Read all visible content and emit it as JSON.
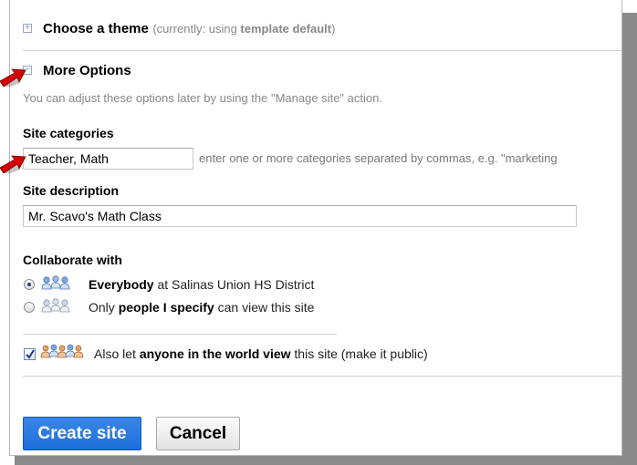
{
  "theme_section": {
    "title": "Choose a theme",
    "currently_prefix": "(currently: using ",
    "currently_value": "template default",
    "currently_suffix": ")"
  },
  "more_options": {
    "title": "More Options",
    "note": "You can adjust these options later by using the \"Manage site\" action."
  },
  "categories": {
    "label": "Site categories",
    "value": "Teacher, Math",
    "hint": "enter one or more categories separated by commas, e.g. \"marketing"
  },
  "description": {
    "label": "Site description",
    "value": "Mr. Scavo's Math Class"
  },
  "collaborate": {
    "label": "Collaborate with",
    "option1": {
      "bold": "Everybody",
      "rest": " at Salinas Union HS District",
      "selected": true
    },
    "option2": {
      "prefix": "Only ",
      "bold": "people I specify",
      "rest": " can view this site",
      "selected": false
    },
    "public": {
      "prefix": "Also let ",
      "bold": "anyone in the world view",
      "rest": " this site (make it public)",
      "checked": true
    }
  },
  "buttons": {
    "create": "Create site",
    "cancel": "Cancel"
  },
  "icons": {
    "expand": "plus-expand-icon",
    "collapse": "minus-collapse-icon",
    "people": "people-group-icon",
    "arrow": "red-arrow-icon"
  },
  "colors": {
    "primary_button": "#2a7ae2",
    "arrow": "#d00000"
  }
}
